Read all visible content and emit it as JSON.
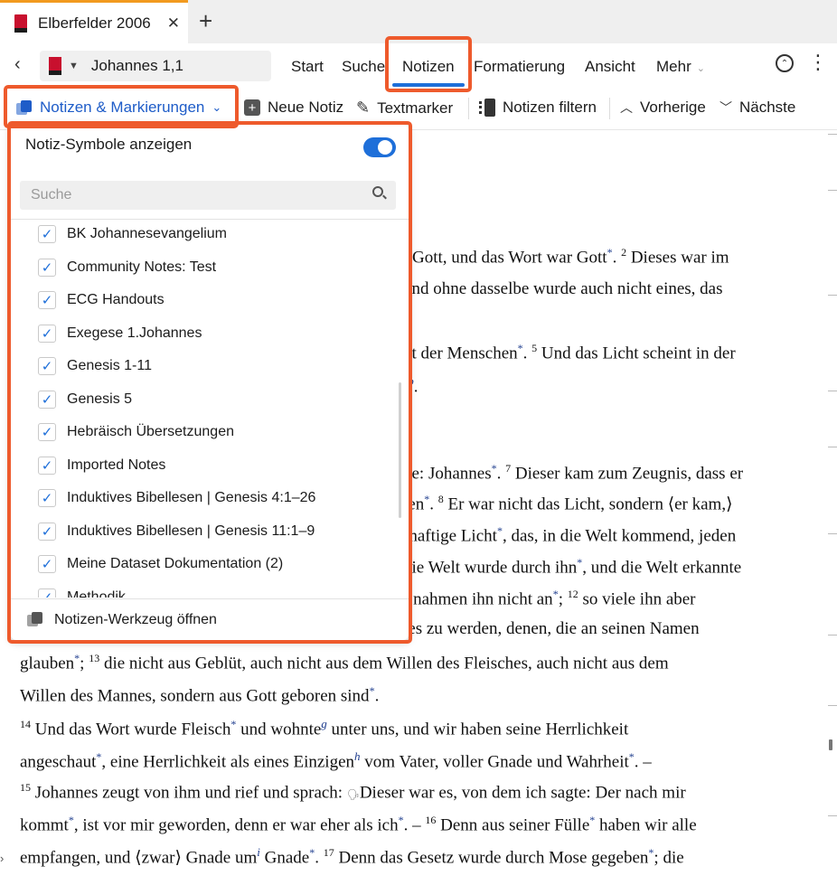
{
  "tab": {
    "title": "Elberfelder 2006",
    "close": "✕",
    "add": "+"
  },
  "nav": {
    "back": "‹",
    "reference": "Johannes 1,1",
    "menu": [
      "Start",
      "Suche",
      "Notizen",
      "Formatierung",
      "Ansicht",
      "Mehr"
    ],
    "active_menu": "Notizen"
  },
  "toolbar": {
    "notes_markings": "Notizen & Markierungen",
    "new_note": "Neue Notiz",
    "highlighter": "Textmarker",
    "filter_notes": "Notizen filtern",
    "previous": "Vorherige",
    "next": "Nächste"
  },
  "dropdown": {
    "show_symbols": "Notiz-Symbole anzeigen",
    "show_symbols_on": true,
    "search_placeholder": "Suche",
    "items": [
      {
        "label": "BK Johannesevangelium",
        "checked": true
      },
      {
        "label": "Community Notes: Test",
        "checked": true
      },
      {
        "label": "ECG Handouts",
        "checked": true
      },
      {
        "label": "Exegese 1.Johannes",
        "checked": true
      },
      {
        "label": "Genesis 1-11",
        "checked": true
      },
      {
        "label": "Genesis 5",
        "checked": true
      },
      {
        "label": "Hebräisch Übersetzungen",
        "checked": true
      },
      {
        "label": "Imported Notes",
        "checked": true
      },
      {
        "label": "Induktives Bibellesen | Genesis 4:1–26",
        "checked": true
      },
      {
        "label": "Induktives Bibellesen | Genesis 11:1–9",
        "checked": true
      },
      {
        "label": "Meine Dataset Dokumentation (2)",
        "checked": true
      },
      {
        "label": "Methodik",
        "checked": true
      }
    ],
    "footer": "Notizen-Werkzeug öffnen"
  },
  "bible": {
    "l1": "i Gott, und das Wort war Gott",
    "l1b": ". ",
    "l1v": "2",
    "l1c": "Dieses war im",
    "l2": "und ohne dasselbe wurde auch nicht eines, das",
    "l3": "ht der Menschen",
    "l3b": ". ",
    "l3v": "5",
    "l3c": "Und das Licht scheint in der",
    "l4": "t",
    "l4n": "b",
    "l4b": ".",
    "l5": "ne: Johannes",
    "l5b": ". ",
    "l5v": "7",
    "l5c": "Dieser kam zum Zeugnis, dass er",
    "l6": "ten",
    "l6b": ". ",
    "l6v": "8",
    "l6c": "Er war nicht das Licht, sondern ⟨er kam,⟩",
    "l7": "rhaftige Licht",
    "l7b": ", das, in die Welt kommend, jeden",
    "l8": " die Welt wurde durch ihn",
    "l8b": ", und die Welt erkannte",
    "l9": "f nahmen ihn nicht an",
    "l9b": "; ",
    "l9v": "12",
    "l9c": "so viele ihn aber",
    "l10": "tes zu werden, denen, die an seinen Namen",
    "l11": "glauben",
    "l11b": "; ",
    "l11v": "13",
    "l11c": "die nicht aus Geblüt, auch nicht aus dem Willen des Fleisches, auch nicht aus dem",
    "l12": "Willen des Mannes, sondern aus Gott geboren sind",
    "l12b": ".",
    "l13v": "14",
    "l13": "Und das Wort wurde Fleisch",
    "l13b": " und wohnte",
    "l13n": "g",
    "l13c": " unter uns, und wir haben seine Herrlichkeit",
    "l14": "angeschaut",
    "l14b": ", eine Herrlichkeit als eines Einzigen",
    "l14n": "h",
    "l14c": " vom Vater, voller Gnade und Wahrheit",
    "l14d": ". –",
    "l15v": "15",
    "l15": "Johannes zeugt von ihm und rief und sprach: ",
    "l15c": "Dieser war es, von dem ich sagte: Der nach mir",
    "l16": "kommt",
    "l16b": ", ist vor mir geworden, denn er war eher als ich",
    "l16c": ". – ",
    "l16v": "16",
    "l16d": "Denn aus seiner Fülle",
    "l16e": " haben wir alle",
    "l17": "empfangen, und ⟨zwar⟩ Gnade um",
    "l17n": "i",
    "l17b": " Gnade",
    "l17c": ". ",
    "l17v": "17",
    "l17d": "Denn das Gesetz wurde durch Mose gegeben",
    "l17e": "; die",
    "star": "*"
  }
}
